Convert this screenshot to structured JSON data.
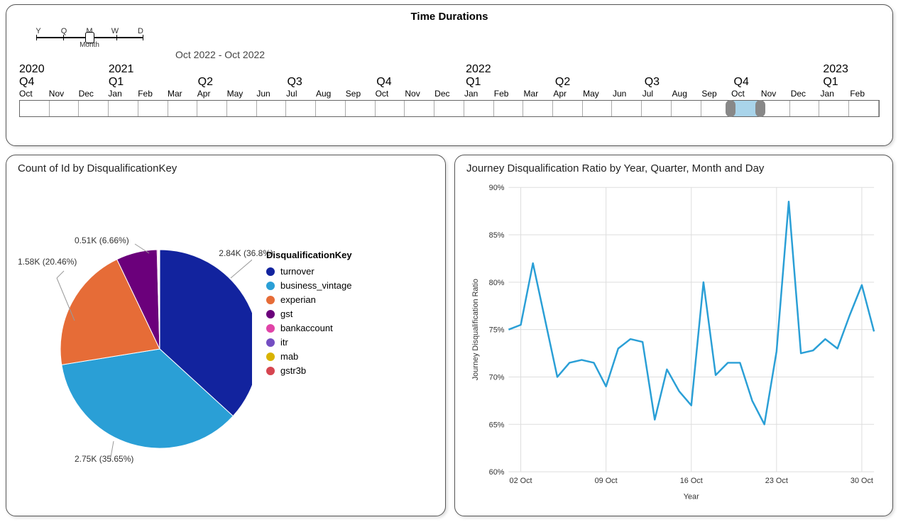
{
  "time_panel": {
    "title": "Time Durations",
    "granularity": {
      "options": [
        "Y",
        "Q",
        "M",
        "W",
        "D"
      ],
      "selected_index": 2,
      "selected_label": "Month"
    },
    "range_text": "Oct 2022 - Oct 2022",
    "years": [
      "2020",
      "2021",
      "",
      "",
      "2022",
      "",
      "",
      "",
      "2023"
    ],
    "quarters": [
      "Q4",
      "Q1",
      "Q2",
      "Q3",
      "Q4",
      "Q1",
      "Q2",
      "Q3",
      "Q4",
      "Q1"
    ],
    "months": [
      "Oct",
      "Nov",
      "Dec",
      "Jan",
      "Feb",
      "Mar",
      "Apr",
      "May",
      "Jun",
      "Jul",
      "Aug",
      "Sep",
      "Oct",
      "Nov",
      "Dec",
      "Jan",
      "Feb",
      "Mar",
      "Apr",
      "May",
      "Jun",
      "Jul",
      "Aug",
      "Sep",
      "Oct",
      "Nov",
      "Dec",
      "Jan",
      "Feb"
    ],
    "selected_month_index": 24
  },
  "pie_panel": {
    "title": "Count of Id by DisqualificationKey",
    "legend_title": "DisqualificationKey",
    "legend": [
      {
        "key": "turnover",
        "color": "#12239e"
      },
      {
        "key": "business_vintage",
        "color": "#2a9fd6"
      },
      {
        "key": "experian",
        "color": "#e66c37"
      },
      {
        "key": "gst",
        "color": "#6b007b"
      },
      {
        "key": "bankaccount",
        "color": "#e044a7"
      },
      {
        "key": "itr",
        "color": "#744ec2"
      },
      {
        "key": "mab",
        "color": "#d9b300"
      },
      {
        "key": "gstr3b",
        "color": "#d64550"
      }
    ],
    "callouts": {
      "turnover": "2.84K (36.8%)",
      "business_vintage": "2.75K (35.65%)",
      "experian": "1.58K (20.46%)",
      "gst": "0.51K (6.66%)"
    }
  },
  "line_panel": {
    "title": "Journey Disqualification Ratio by Year, Quarter, Month and Day",
    "ylabel": "Journey Disqualification Ratio",
    "xlabel": "Year",
    "yticks": [
      "60%",
      "65%",
      "70%",
      "75%",
      "80%",
      "85%",
      "90%"
    ],
    "xticks": [
      "02 Oct",
      "09 Oct",
      "16 Oct",
      "23 Oct",
      "30 Oct"
    ]
  },
  "chart_data": [
    {
      "type": "pie",
      "title": "Count of Id by DisqualificationKey",
      "series": [
        {
          "name": "turnover",
          "value": 2840,
          "pct": 36.8,
          "label": "2.84K (36.8%)",
          "color": "#12239e"
        },
        {
          "name": "business_vintage",
          "value": 2750,
          "pct": 35.65,
          "label": "2.75K (35.65%)",
          "color": "#2a9fd6"
        },
        {
          "name": "experian",
          "value": 1580,
          "pct": 20.46,
          "label": "1.58K (20.46%)",
          "color": "#e66c37"
        },
        {
          "name": "gst",
          "value": 510,
          "pct": 6.66,
          "label": "0.51K (6.66%)",
          "color": "#6b007b"
        },
        {
          "name": "bankaccount",
          "value": 12,
          "pct": 0.16,
          "color": "#e044a7"
        },
        {
          "name": "itr",
          "value": 9,
          "pct": 0.12,
          "color": "#744ec2"
        },
        {
          "name": "mab",
          "value": 8,
          "pct": 0.1,
          "color": "#d9b300"
        },
        {
          "name": "gstr3b",
          "value": 4,
          "pct": 0.05,
          "color": "#d64550"
        }
      ]
    },
    {
      "type": "line",
      "title": "Journey Disqualification Ratio by Year, Quarter, Month and Day",
      "xlabel": "Year",
      "ylabel": "Journey Disqualification Ratio",
      "ylim": [
        60,
        90
      ],
      "x": [
        1,
        2,
        3,
        4,
        5,
        6,
        7,
        8,
        9,
        10,
        11,
        12,
        13,
        14,
        15,
        16,
        17,
        18,
        19,
        20,
        21,
        22,
        23,
        24,
        25,
        26,
        27,
        28,
        29,
        30,
        31
      ],
      "x_tick_labels": {
        "2": "02 Oct",
        "9": "09 Oct",
        "16": "16 Oct",
        "23": "23 Oct",
        "30": "30 Oct"
      },
      "series": [
        {
          "name": "Journey Disqualification Ratio",
          "color": "#2a9fd6",
          "values": [
            75.0,
            75.5,
            82.0,
            76.0,
            70.0,
            71.5,
            71.8,
            71.5,
            69.0,
            73.0,
            74.0,
            73.7,
            65.5,
            70.8,
            68.5,
            67.0,
            80.0,
            70.2,
            71.5,
            71.5,
            67.5,
            65.0,
            72.7,
            88.5,
            72.5,
            72.8,
            74.0,
            73.0,
            76.5,
            79.7,
            74.8
          ]
        }
      ]
    }
  ]
}
